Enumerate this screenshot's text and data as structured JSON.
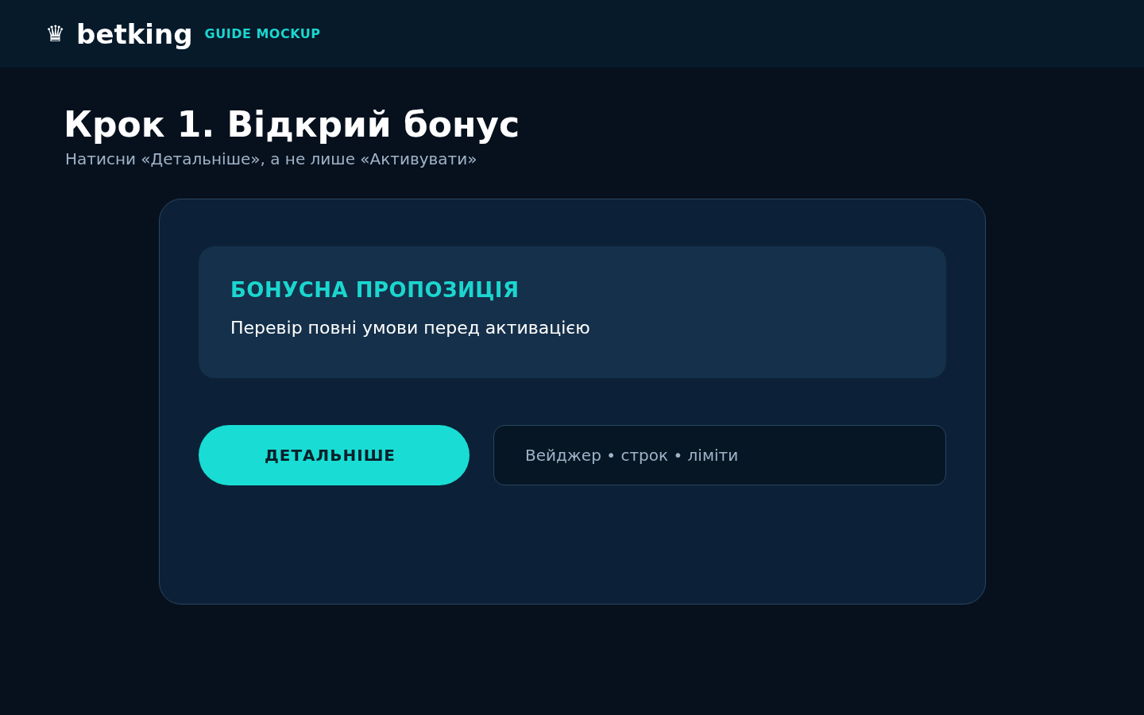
{
  "header": {
    "logo_icon": "♛",
    "brand": "betking",
    "tag": "GUIDE MOCKUP"
  },
  "step": {
    "title": "Крок 1. Відкрий бонус",
    "subtitle": "Натисни «Детальніше», а не лише «Активувати»"
  },
  "offer": {
    "heading": "БОНУСНА ПРОПОЗИЦІЯ",
    "text": "Перевір повні умови перед активацією"
  },
  "actions": {
    "button": "ДЕТАЛЬНІШЕ",
    "terms": "Вейджер • строк • ліміти"
  }
}
